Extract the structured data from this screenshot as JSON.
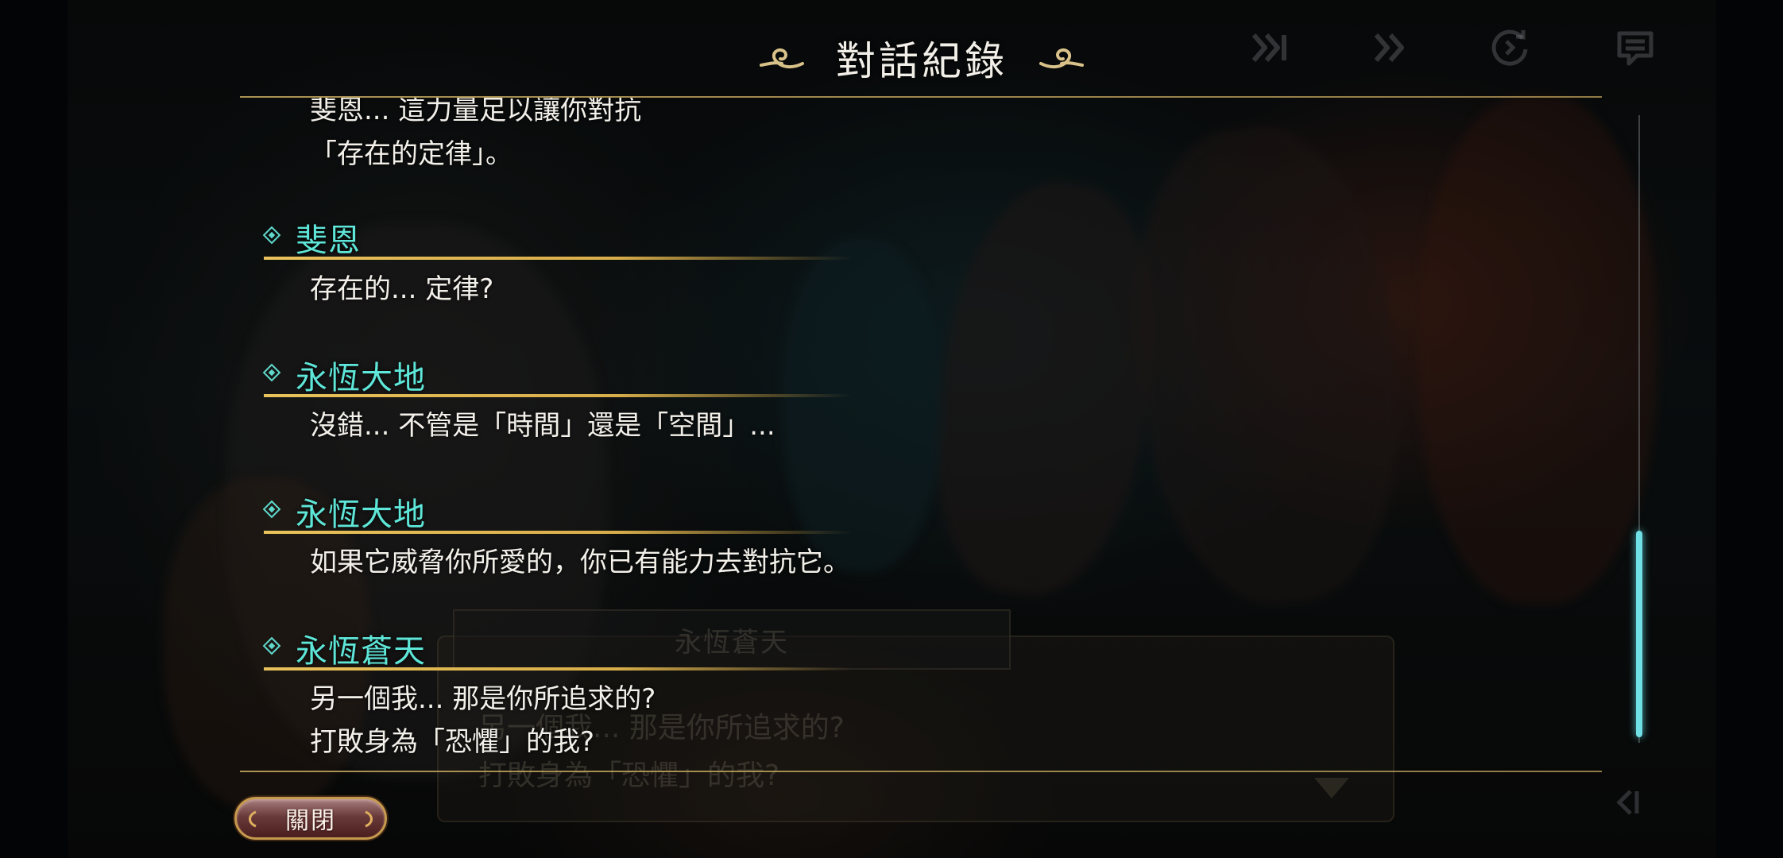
{
  "header": {
    "title": "對話紀錄"
  },
  "controls": {
    "skip_all_icon": "double-chevron-bar-icon",
    "fast_forward_icon": "double-chevron-icon",
    "auto_icon": "circle-arrow-icon",
    "log_icon": "message-list-icon",
    "corner_icon": "skip-end-icon"
  },
  "log": {
    "first_entry": {
      "lines": [
        "斐恩... 這力量足以讓你對抗",
        "「存在的定律」。"
      ]
    },
    "entries": [
      {
        "speaker": "斐恩",
        "lines": [
          "存在的... 定律?"
        ]
      },
      {
        "speaker": "永恆大地",
        "lines": [
          "沒錯... 不管是「時間」還是「空間」..."
        ]
      },
      {
        "speaker": "永恆大地",
        "lines": [
          "如果它威脅你所愛的，你已有能力去對抗它。"
        ]
      },
      {
        "speaker": "永恆蒼天",
        "lines": [
          "另一個我... 那是你所追求的?",
          "打敗身為「恐懼」的我?"
        ]
      }
    ]
  },
  "underlying_dialogue": {
    "name": "永恆蒼天",
    "lines": [
      "另一個我... 那是你所追求的?",
      "打敗身為「恐懼」的我?"
    ]
  },
  "scrollbar": {
    "position_fraction": 0.86
  },
  "footer": {
    "close_label": "關閉"
  },
  "colors": {
    "speaker_name": "#5ee6d8",
    "underline_gold": "#e8c25a",
    "scroll_thumb": "#6fe0e6",
    "close_button": "#6a3a3a"
  }
}
